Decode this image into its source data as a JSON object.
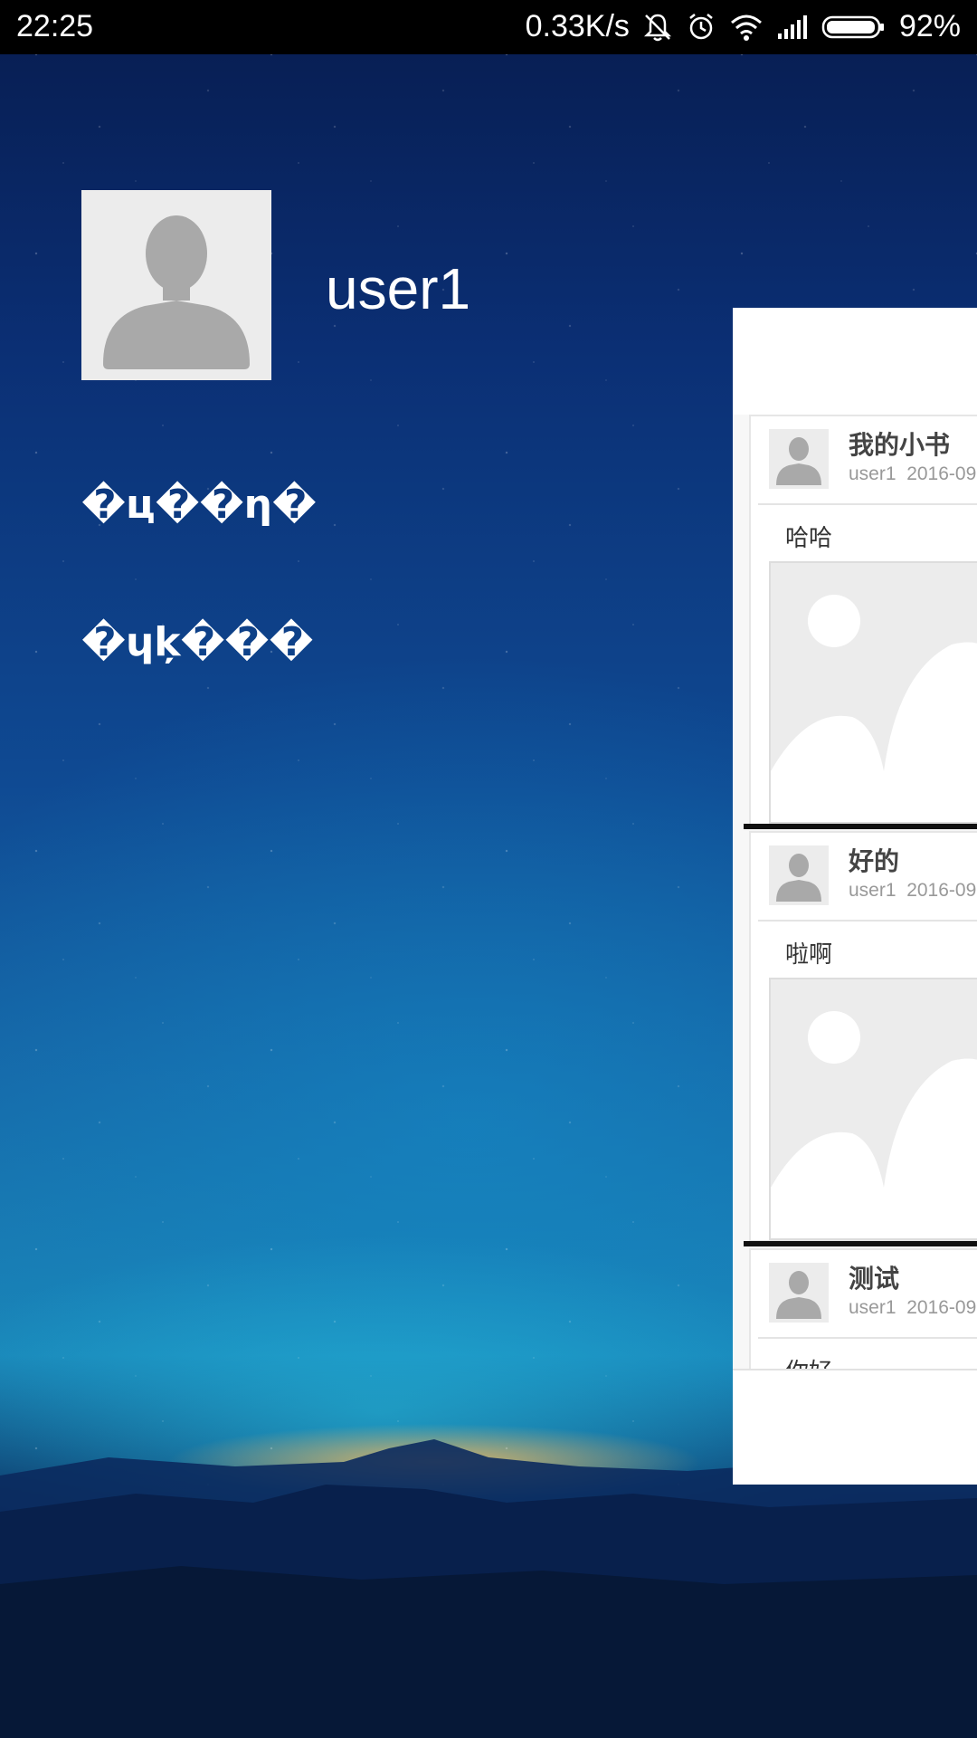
{
  "status_bar": {
    "time": "22:25",
    "network_speed": "0.33K/s",
    "battery": "92%",
    "icons": [
      "mute-icon",
      "alarm-icon",
      "wifi-icon",
      "signal-icon",
      "battery-icon"
    ]
  },
  "profile": {
    "username": "user1",
    "avatar_icon": "person-placeholder-icon"
  },
  "menu": {
    "items": [
      {
        "label": "�ц��η�"
      },
      {
        "label": "�ɥķ���"
      }
    ]
  },
  "posts": [
    {
      "title": "我的小书",
      "user": "user1",
      "date": "2016-09",
      "content": "哈哈",
      "image_icon": "image-placeholder-icon"
    },
    {
      "title": "好的",
      "user": "user1",
      "date": "2016-09",
      "content": "啦啊",
      "image_icon": "image-placeholder-icon"
    },
    {
      "title": "测试",
      "user": "user1",
      "date": "2016-09",
      "content": "你好",
      "image_icon": "image-placeholder-icon"
    }
  ],
  "colors": {
    "status_bar": "#000000",
    "panel": "#ffffff",
    "placeholder": "#ececec",
    "placeholder_shape": "#a9a9a9"
  }
}
